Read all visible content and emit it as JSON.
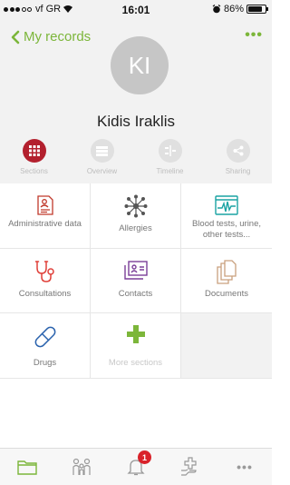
{
  "status_bar": {
    "carrier": "vf GR",
    "time": "16:01",
    "battery": "86%",
    "battery_level": 0.86
  },
  "header": {
    "back_label": "My records",
    "more_label": "•••",
    "avatar_initials": "KI",
    "user_name": "Kidis Iraklis"
  },
  "view_tabs": [
    {
      "label": "Sections",
      "icon": "grid-icon",
      "active": true
    },
    {
      "label": "Overview",
      "icon": "list-icon",
      "active": false
    },
    {
      "label": "Timeline",
      "icon": "timeline-icon",
      "active": false
    },
    {
      "label": "Sharing",
      "icon": "share-icon",
      "active": false
    }
  ],
  "sections": [
    {
      "label": "Administrative data",
      "icon": "id-document-icon",
      "color": "#c0392b"
    },
    {
      "label": "Allergies",
      "icon": "allergen-icon",
      "color": "#555555"
    },
    {
      "label": "Blood tests, urine, other tests...",
      "icon": "lab-monitor-icon",
      "color": "#1aa3a3"
    },
    {
      "label": "Consultations",
      "icon": "stethoscope-icon",
      "color": "#e0403a"
    },
    {
      "label": "Contacts",
      "icon": "contacts-icon",
      "color": "#7b3f98"
    },
    {
      "label": "Documents",
      "icon": "documents-icon",
      "color": "#c9a07e"
    },
    {
      "label": "Drugs",
      "icon": "capsule-icon",
      "color": "#2a62ad"
    },
    {
      "label": "More sections",
      "icon": "plus-icon",
      "color": "#7cb63a"
    }
  ],
  "bottom_tabs": [
    {
      "icon": "folder-icon",
      "active": true
    },
    {
      "icon": "family-icon",
      "active": false
    },
    {
      "icon": "bell-icon",
      "active": false,
      "badge": "1"
    },
    {
      "icon": "medical-hand-icon",
      "active": false
    },
    {
      "icon": "more-icon",
      "active": false,
      "label": "•••"
    }
  ],
  "colors": {
    "accent": "#7cb63a",
    "active_tab": "#b3202e",
    "badge": "#d9222a"
  }
}
